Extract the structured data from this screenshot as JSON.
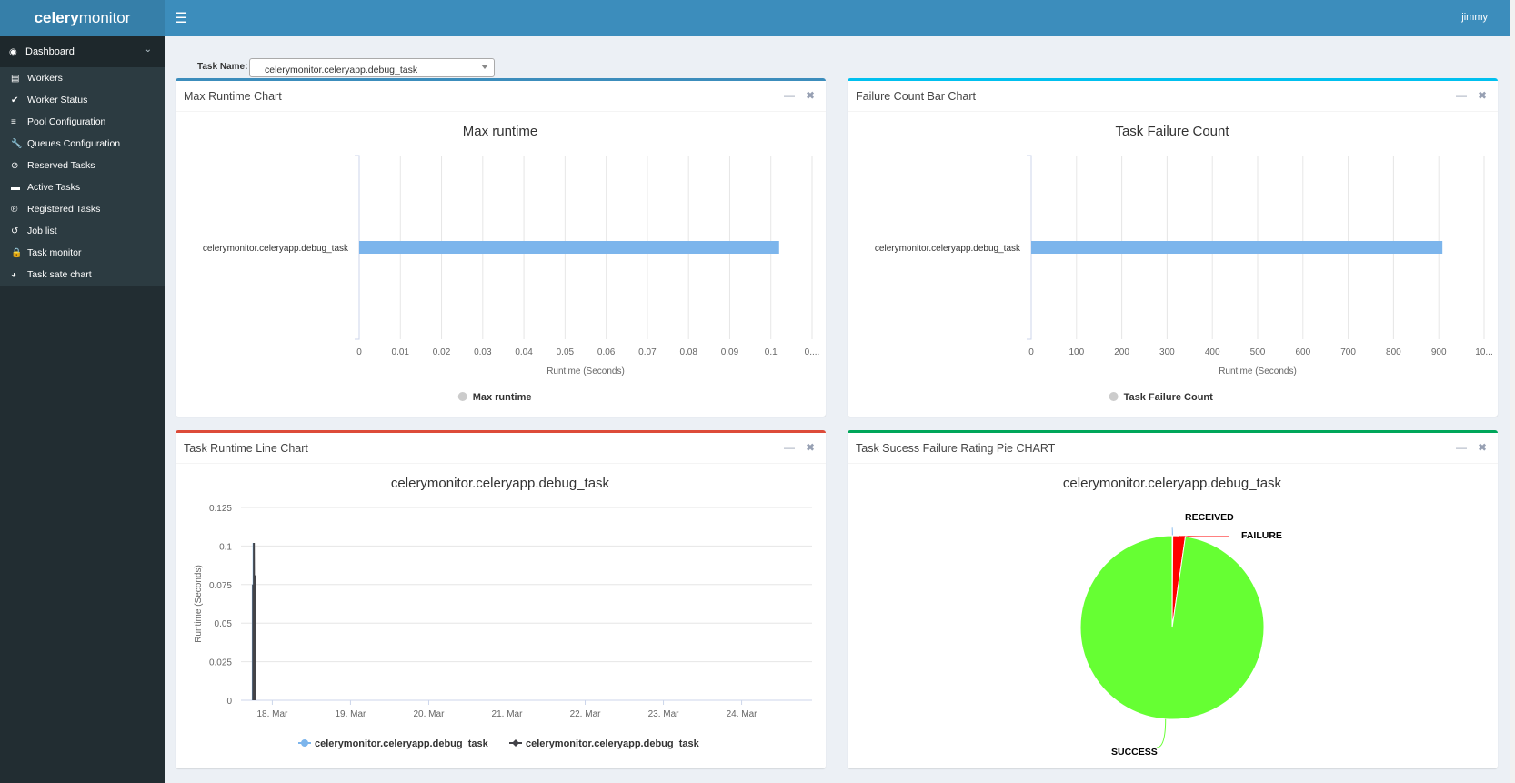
{
  "app": {
    "logo_bold": "celery",
    "logo_light": "monitor",
    "user": "jimmy"
  },
  "sidebar": {
    "dashboard": {
      "label": "Dashboard",
      "icon": "dashboard-icon"
    },
    "items": [
      {
        "label": "Workers",
        "icon": "server-icon",
        "glyph": "▤"
      },
      {
        "label": "Worker Status",
        "icon": "check-icon",
        "glyph": "✔"
      },
      {
        "label": "Pool Configuration",
        "icon": "list-icon",
        "glyph": "≡"
      },
      {
        "label": "Queues Configuration",
        "icon": "wrench-icon",
        "glyph": "🔧"
      },
      {
        "label": "Reserved Tasks",
        "icon": "ban-icon",
        "glyph": "⊘"
      },
      {
        "label": "Active Tasks",
        "icon": "tasks-icon",
        "glyph": "▬"
      },
      {
        "label": "Registered Tasks",
        "icon": "registered-icon",
        "glyph": "®"
      },
      {
        "label": "Job list",
        "icon": "history-icon",
        "glyph": "↺"
      },
      {
        "label": "Task monitor",
        "icon": "lock-icon",
        "glyph": "🔒"
      },
      {
        "label": "Task sate chart",
        "icon": "pie-chart-icon",
        "glyph": "◕"
      }
    ]
  },
  "filter": {
    "label": "Task Name:",
    "value": "celerymonitor.celeryapp.debug_task"
  },
  "panels": {
    "max_runtime": {
      "title": "Max Runtime Chart"
    },
    "failure_count": {
      "title": "Failure Count Bar Chart"
    },
    "runtime_line": {
      "title": "Task Runtime Line Chart"
    },
    "pie": {
      "title": "Task Sucess Failure Rating Pie CHART"
    }
  },
  "colors": {
    "bar": "#7cb5ec",
    "line": "#434348",
    "success": "#66ff33",
    "failure": "#ff0000",
    "received": "#7cb5ec",
    "primary": "#3c8dbc",
    "info": "#00c0ef",
    "danger": "#dd4b39",
    "success_border": "#00a65a"
  },
  "chart_data": [
    {
      "type": "bar",
      "orientation": "horizontal",
      "title": "Max runtime",
      "categories": [
        "celerymonitor.celeryapp.debug_task"
      ],
      "values": [
        0.102
      ],
      "xlabel": "Runtime (Seconds)",
      "ticks": [
        "0",
        "0.01",
        "0.02",
        "0.03",
        "0.04",
        "0.05",
        "0.06",
        "0.07",
        "0.08",
        "0.09",
        "0.1",
        "0...."
      ],
      "xlim": [
        0,
        0.11
      ],
      "legend": [
        "Max runtime"
      ],
      "legend_position": "bottom",
      "grid": true
    },
    {
      "type": "bar",
      "orientation": "horizontal",
      "title": "Task Failure Count",
      "categories": [
        "celerymonitor.celeryapp.debug_task"
      ],
      "values": [
        908
      ],
      "xlabel": "Runtime (Seconds)",
      "ticks": [
        "0",
        "100",
        "200",
        "300",
        "400",
        "500",
        "600",
        "700",
        "800",
        "900",
        "10..."
      ],
      "xlim": [
        0,
        1000
      ],
      "legend": [
        "Task Failure Count"
      ],
      "legend_position": "bottom",
      "grid": true
    },
    {
      "type": "line",
      "title": "celerymonitor.celeryapp.debug_task",
      "ylabel": "Runtime (Seconds)",
      "yticks": [
        "0",
        "0.025",
        "0.05",
        "0.075",
        "0.1",
        "0.125"
      ],
      "ylim": [
        0,
        0.125
      ],
      "xticks": [
        "18. Mar",
        "19. Mar",
        "20. Mar",
        "21. Mar",
        "22. Mar",
        "23. Mar",
        "24. Mar"
      ],
      "xlim_days": [
        17.6,
        24.9
      ],
      "series": [
        {
          "name": "celerymonitor.celeryapp.debug_task",
          "color": "#7cb5ec",
          "x_days": [
            17.75,
            17.75,
            17.76,
            17.76,
            17.77,
            17.77
          ],
          "values": [
            0,
            0.075,
            0.0,
            0.102,
            0.0,
            0.081
          ]
        },
        {
          "name": "celerymonitor.celeryapp.debug_task",
          "color": "#434348",
          "x_days": [
            17.75,
            17.75,
            17.76,
            17.76,
            17.77,
            17.77
          ],
          "values": [
            0,
            0.075,
            0.0,
            0.102,
            0.0,
            0.081
          ]
        }
      ],
      "legend_position": "bottom",
      "grid": true
    },
    {
      "type": "pie",
      "title": "celerymonitor.celeryapp.debug_task",
      "slices": [
        {
          "label": "RECEIVED",
          "value": 0.1,
          "color": "#7cb5ec"
        },
        {
          "label": "FAILURE",
          "value": 2.2,
          "color": "#ff0000"
        },
        {
          "label": "SUCCESS",
          "value": 97.7,
          "color": "#66ff33"
        }
      ]
    }
  ]
}
